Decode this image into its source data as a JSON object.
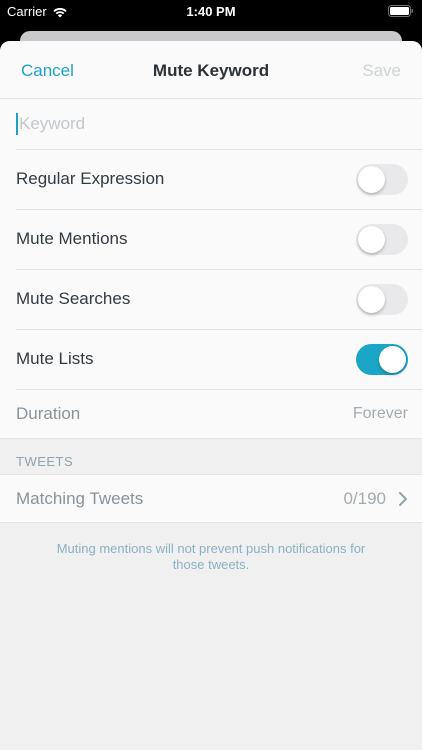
{
  "status_bar": {
    "carrier": "Carrier",
    "time": "1:40 PM",
    "icons": [
      "wifi-icon",
      "battery-icon"
    ]
  },
  "nav": {
    "cancel": "Cancel",
    "title": "Mute Keyword",
    "save": "Save"
  },
  "keyword": {
    "placeholder": "Keyword",
    "value": ""
  },
  "options": [
    {
      "label": "Regular Expression",
      "on": false
    },
    {
      "label": "Mute Mentions",
      "on": false
    },
    {
      "label": "Mute Searches",
      "on": false
    },
    {
      "label": "Mute Lists",
      "on": true
    }
  ],
  "duration": {
    "label": "Duration",
    "value": "Forever"
  },
  "tweets_section": {
    "header": "TWEETS",
    "matching_label": "Matching Tweets",
    "matching_count": "0/190"
  },
  "footer_note": "Muting mentions will not prevent push notifications for those tweets.",
  "colors": {
    "accent": "#1da1c9",
    "toggle_on": "#1ba5c6",
    "toggle_off": "#e9e9eb"
  }
}
